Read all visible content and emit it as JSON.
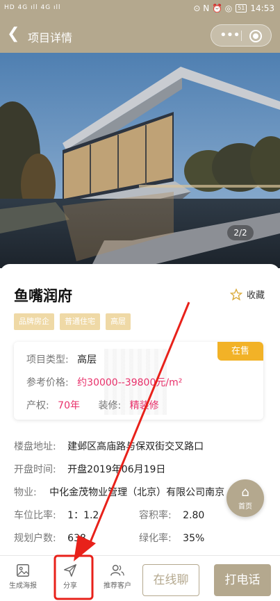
{
  "status_bar": {
    "signal": "HD 4G ıll 4G ıll",
    "battery": "51",
    "time": "14:53"
  },
  "nav": {
    "title": "项目详情",
    "back_icon": "chevron-left-icon",
    "more_icon": "more-dots-icon",
    "close_icon": "target-circle-icon"
  },
  "gallery": {
    "pager": "2/2"
  },
  "project": {
    "name": "鱼嘴润府",
    "favorite_label": "收藏",
    "tags": [
      "品牌房企",
      "普通住宅",
      "高层"
    ]
  },
  "summary": {
    "status_badge": "在售",
    "type_label": "项目类型:",
    "type_value": "高层",
    "price_label": "参考价格:",
    "price_value": "约30000--39800元/m²",
    "property_label": "产权:",
    "property_value": "70年",
    "decor_label": "装修:",
    "decor_value": "精装修"
  },
  "details": {
    "address_label": "楼盘地址:",
    "address_value": "建邺区高庙路与保双街交叉路口",
    "open_label": "开盘时间:",
    "open_value": "开盘2019年06月19日",
    "mgmt_label": "物业:",
    "mgmt_value": "中化金茂物业管理（北京）有限公司南京",
    "parking_label": "车位比率:",
    "parking_value": "1：1.2",
    "plot_label": "容积率:",
    "plot_value": "2.80",
    "households_label": "规划户数:",
    "households_value": "638",
    "green_label": "绿化率:",
    "green_value": "35%"
  },
  "float_home": {
    "label": "首页"
  },
  "bottom_bar": {
    "poster_label": "生成海报",
    "share_label": "分享",
    "recommend_label": "推荐客户",
    "chat_label": "在线聊",
    "call_label": "打电话"
  },
  "colors": {
    "theme": "#b4a88e",
    "price": "#e8306a",
    "badge": "#f2b227",
    "tag": "#efd9a6",
    "annotation": "#e8211a"
  }
}
